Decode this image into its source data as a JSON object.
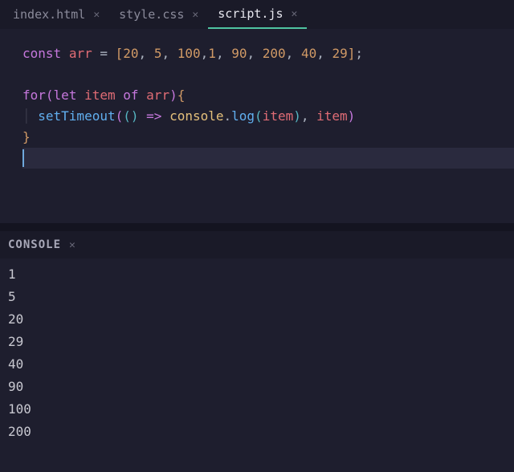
{
  "tabs": [
    {
      "label": "index.html",
      "active": false
    },
    {
      "label": "style.css",
      "active": false
    },
    {
      "label": "script.js",
      "active": true
    }
  ],
  "code": {
    "l1": {
      "const": "const",
      "arr": "arr",
      "eq": "=",
      "lb": "[",
      "n0": "20",
      "c0": ",",
      "n1": "5",
      "c1": ",",
      "n2": "100",
      "c2": ",",
      "n3": "1",
      "c3": ",",
      "n4": "90",
      "c4": ",",
      "n5": "200",
      "c5": ",",
      "n6": "40",
      "c6": ",",
      "n7": "29",
      "rb": "]",
      "semi": ";"
    },
    "l3": {
      "for": "for",
      "lp": "(",
      "let": "let",
      "item": "item",
      "of": "of",
      "arr": "arr",
      "rp": ")",
      "lb": "{"
    },
    "l4": {
      "fn": "setTimeout",
      "lp1": "(",
      "lp2": "(",
      "rp2": ")",
      "arrow": "=>",
      "console": "console",
      "dot": ".",
      "log": "log",
      "lp3": "(",
      "item1": "item",
      "rp3": ")",
      "comma": ",",
      "item2": "item",
      "rp1": ")"
    },
    "l5": {
      "rb": "}"
    }
  },
  "console": {
    "label": "CONSOLE",
    "output": [
      "1",
      "5",
      "20",
      "29",
      "40",
      "90",
      "100",
      "200"
    ]
  }
}
